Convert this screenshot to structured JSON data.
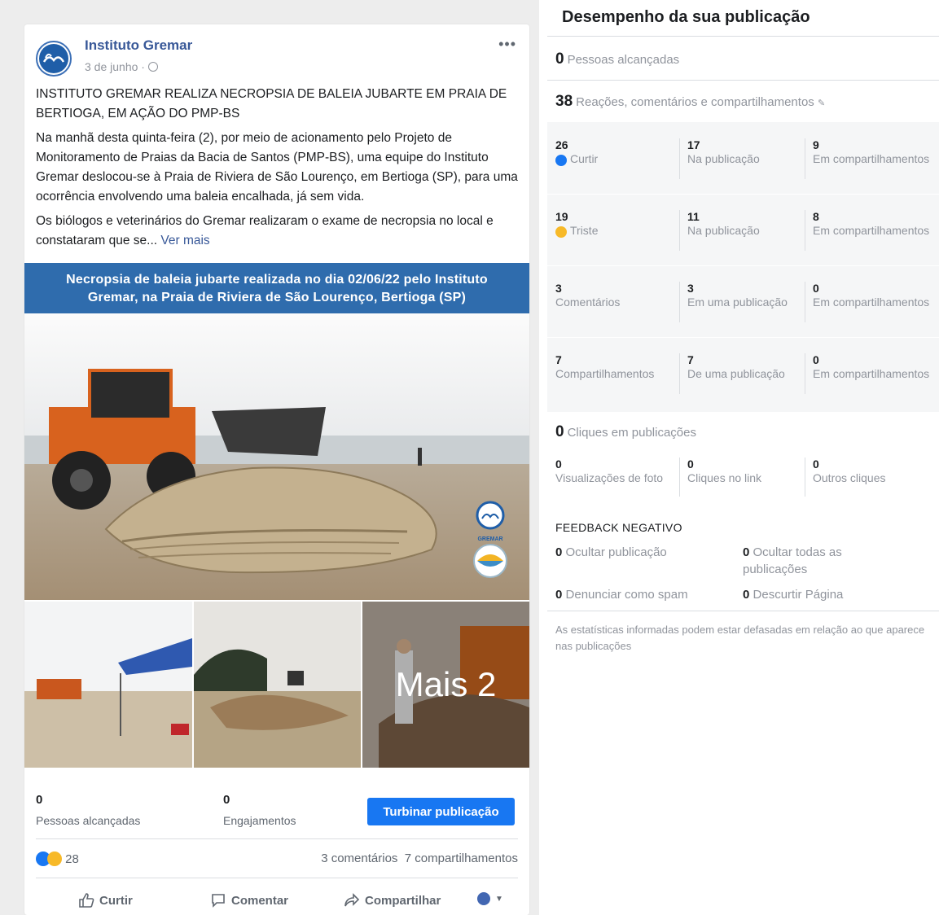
{
  "post": {
    "page_name": "Instituto Gremar",
    "date": "3 de junho ·",
    "menu": "•••",
    "headline": "INSTITUTO GREMAR REALIZA NECROPSIA DE BALEIA JUBARTE EM PRAIA DE BERTIOGA, EM AÇÃO DO PMP-BS",
    "paragraph1": "Na manhã desta quinta-feira (2), por meio de acionamento pelo Projeto de Monitoramento de Praias da Bacia de Santos (PMP-BS), uma equipe do Instituto Gremar deslocou-se à Praia de Riviera de São Lourenço, em Bertioga (SP), para uma ocorrência envolvendo uma baleia encalhada, já sem vida.",
    "paragraph2": "Os biólogos e veterinários do Gremar realizaram o exame de necropsia no local e constataram que se...",
    "see_more": "Ver mais",
    "banner_line1": "Necropsia de baleia jubarte realizada no dia 02/06/22 pelo Instituto",
    "banner_line2": "Gremar, na Praia de Riviera de São Lourenço, Bertioga (SP)",
    "logo_label": "GREMAR",
    "more_photos": "Mais 2",
    "reach_value": "0",
    "reach_label": "Pessoas alcançadas",
    "engagement_value": "0",
    "engagement_label": "Engajamentos",
    "boost_button": "Turbinar publicação",
    "reaction_count": "28",
    "comments_count": "3 comentários",
    "shares_count": "7 compartilhamentos",
    "action_like": "Curtir",
    "action_comment": "Comentar",
    "action_share": "Compartilhar"
  },
  "insights": {
    "title": "Desempenho da sua publicação",
    "reach_value": "0",
    "reach_label": "Pessoas alcançadas",
    "engagement_value": "38",
    "engagement_label": "Reações, comentários e compartilhamentos",
    "grid": [
      [
        {
          "v": "26",
          "l": "Curtir"
        },
        {
          "v": "17",
          "l": "Na publicação"
        },
        {
          "v": "9",
          "l": "Em compartilhamentos"
        }
      ],
      [
        {
          "v": "19",
          "l": "Triste"
        },
        {
          "v": "11",
          "l": "Na publicação"
        },
        {
          "v": "8",
          "l": "Em compartilhamentos"
        }
      ],
      [
        {
          "v": "3",
          "l": "Comentários"
        },
        {
          "v": "3",
          "l": "Em uma publicação"
        },
        {
          "v": "0",
          "l": "Em compartilhamentos"
        }
      ],
      [
        {
          "v": "7",
          "l": "Compartilhamentos"
        },
        {
          "v": "7",
          "l": "De uma publicação"
        },
        {
          "v": "0",
          "l": "Em compartilhamentos"
        }
      ]
    ],
    "clicks_value": "0",
    "clicks_label": "Cliques em publicações",
    "clicks": [
      {
        "v": "0",
        "l": "Visualizações de foto"
      },
      {
        "v": "0",
        "l": "Cliques no link"
      },
      {
        "v": "0",
        "l": "Outros cliques"
      }
    ],
    "negative_title": "FEEDBACK NEGATIVO",
    "negative": [
      {
        "v": "0",
        "l": "Ocultar publicação"
      },
      {
        "v": "0",
        "l": "Ocultar todas as publicações"
      },
      {
        "v": "0",
        "l": "Denunciar como spam"
      },
      {
        "v": "0",
        "l": "Descurtir Página"
      }
    ],
    "note": "As estatísticas informadas podem estar defasadas em relação ao que aparece nas publicações"
  }
}
